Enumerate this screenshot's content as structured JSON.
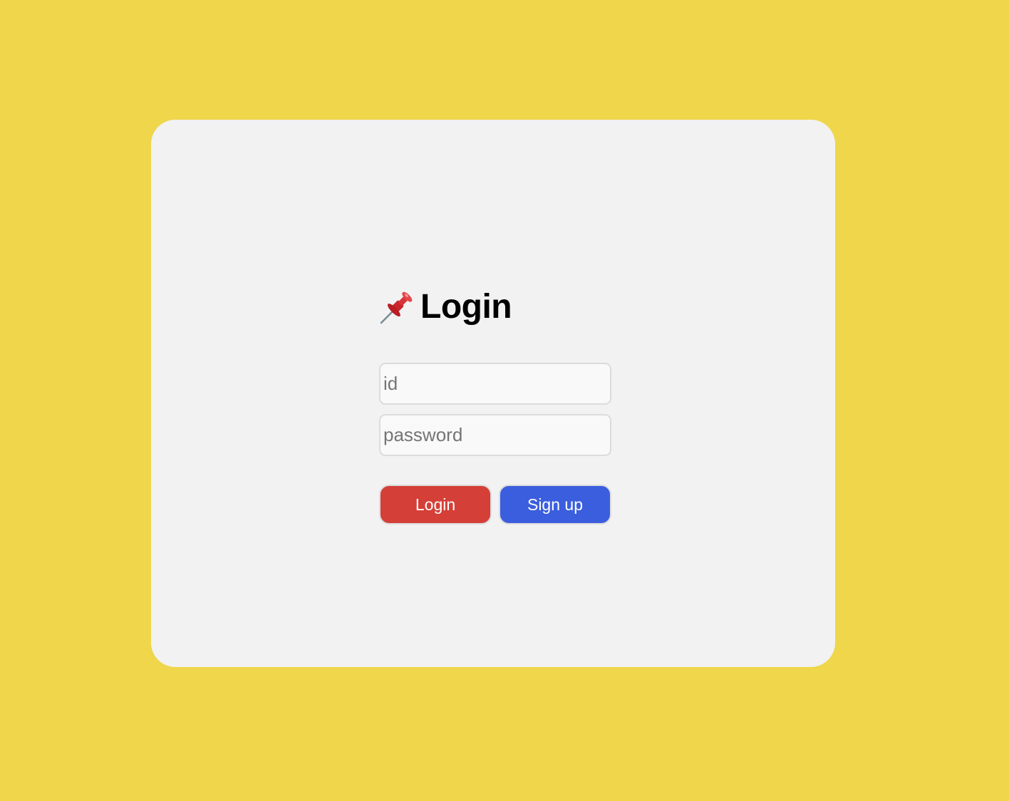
{
  "colors": {
    "background": "#EFD64B",
    "card": "#F2F2F2",
    "login_button": "#D43F37",
    "signup_button": "#3B5EDE"
  },
  "header": {
    "icon": "pushpin-icon",
    "title": "Login"
  },
  "form": {
    "id_placeholder": "id",
    "id_value": "",
    "password_placeholder": "password",
    "password_value": ""
  },
  "actions": {
    "login_label": "Login",
    "signup_label": "Sign up"
  }
}
